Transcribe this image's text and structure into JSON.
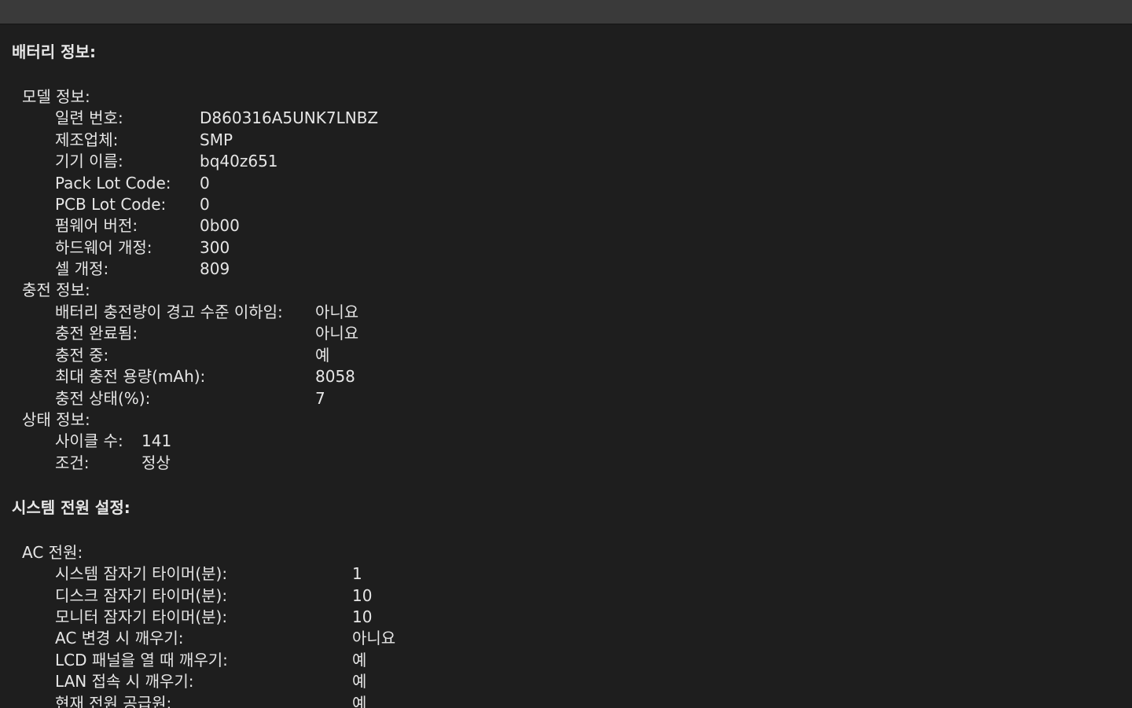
{
  "battery": {
    "title": "배터리 정보:",
    "model": {
      "heading": "모델 정보:",
      "rows": [
        {
          "label": "일련 번호:",
          "value": "D860316A5UNK7LNBZ"
        },
        {
          "label": "제조업체:",
          "value": "SMP"
        },
        {
          "label": "기기 이름:",
          "value": "bq40z651"
        },
        {
          "label": "Pack Lot Code:",
          "value": "0"
        },
        {
          "label": "PCB Lot Code:",
          "value": "0"
        },
        {
          "label": "펌웨어 버전:",
          "value": "0b00"
        },
        {
          "label": "하드웨어 개정:",
          "value": "300"
        },
        {
          "label": "셀 개정:",
          "value": "809"
        }
      ]
    },
    "charge": {
      "heading": "충전 정보:",
      "rows": [
        {
          "label": "배터리 충전량이 경고 수준 이하임:",
          "value": "아니요"
        },
        {
          "label": "충전 완료됨:",
          "value": "아니요"
        },
        {
          "label": "충전 중:",
          "value": "예"
        },
        {
          "label": "최대 충전 용량(mAh):",
          "value": "8058"
        },
        {
          "label": "충전 상태(%):",
          "value": "7"
        }
      ]
    },
    "health": {
      "heading": "상태 정보:",
      "rows": [
        {
          "label": "사이클 수:",
          "value": "141"
        },
        {
          "label": "조건:",
          "value": "정상"
        }
      ]
    }
  },
  "power": {
    "title": "시스템 전원 설정:",
    "ac": {
      "heading": "AC 전원:",
      "rows": [
        {
          "label": "시스템 잠자기 타이머(분):",
          "value": "1"
        },
        {
          "label": "디스크 잠자기 타이머(분):",
          "value": "10"
        },
        {
          "label": "모니터 잠자기 타이머(분):",
          "value": "10"
        },
        {
          "label": "AC 변경 시 깨우기:",
          "value": "아니요"
        },
        {
          "label": "LCD 패널을 열 때 깨우기:",
          "value": "예"
        },
        {
          "label": "LAN 접속 시 깨우기:",
          "value": "예"
        },
        {
          "label": "현재 전원 공급원:",
          "value": "예"
        }
      ]
    }
  }
}
